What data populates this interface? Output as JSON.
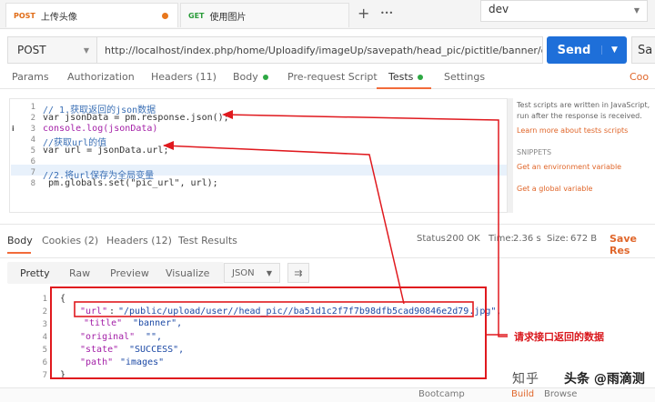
{
  "tabs": [
    {
      "method": "POST",
      "label": "上传头像"
    },
    {
      "method": "GET",
      "label": "使用图片"
    }
  ],
  "tab_add": "+",
  "tab_more": "•••",
  "environment": "dev",
  "request": {
    "method": "POST",
    "url": "http://localhost/index.php/home/Uploadify/imageUp/savepath/head_pic/pictitle/banner/dir/images",
    "send_label": "Send",
    "save_label": "Sa"
  },
  "request_tabs": [
    "Params",
    "Authorization",
    "Headers (11)",
    "Body",
    "Pre-request Script",
    "Tests",
    "Settings",
    "Coo"
  ],
  "editor_lines": [
    {
      "n": "1",
      "text": "// 1.获取返回的json数据"
    },
    {
      "n": "2",
      "text": "var jsonData = pm.response.json();"
    },
    {
      "n": "3",
      "text": "console.log(jsonData)",
      "info": "i"
    },
    {
      "n": "4",
      "text": "//获取url的值"
    },
    {
      "n": "5",
      "text": "var url = jsonData.url;"
    },
    {
      "n": "6",
      "text": ""
    },
    {
      "n": "7",
      "text": "//2.将url保存为全局变量"
    },
    {
      "n": "8",
      "text": " pm.globals.set(\"pic_url\", url);"
    }
  ],
  "side_panel": {
    "desc1": "Test scripts are written in JavaScript,",
    "desc2": "run after the response is received.",
    "learn": "Learn more about tests scripts",
    "snippets": "SNIPPETS",
    "snip1": "Get an environment variable",
    "snip2": "Get a global variable"
  },
  "response_tabs": [
    "Body",
    "Cookies (2)",
    "Headers (12)",
    "Test Results"
  ],
  "status": {
    "label": "Status:",
    "value": "200 OK",
    "time_label": "Time:",
    "time": "2.36 s",
    "size_label": "Size:",
    "size": "672 B"
  },
  "save_response": "Save Res",
  "view_tabs": [
    "Pretty",
    "Raw",
    "Preview",
    "Visualize"
  ],
  "format": "JSON",
  "response_lines": [
    {
      "n": "1",
      "text": "{"
    },
    {
      "n": "2",
      "key": "\"url\"",
      "val": "\"/public/upload/user//head_pic//ba51d1c2f7f7b98dfb5cad90846e2d79.jpg\","
    },
    {
      "n": "3",
      "key": "\"title\"",
      "val": "\"banner\","
    },
    {
      "n": "4",
      "key": "\"original\"",
      "val": "\"\","
    },
    {
      "n": "5",
      "key": "\"state\"",
      "val": "\"SUCCESS\","
    },
    {
      "n": "6",
      "key": "\"path\"",
      "val": "\"images\""
    },
    {
      "n": "7",
      "text": "}"
    }
  ],
  "annotation": "请求接口返回的数据",
  "watermark": {
    "a": "知乎",
    "b": "头条 @雨滴测试"
  },
  "footer": {
    "bootcamp": "Bootcamp",
    "build": "Build",
    "browse": "Browse"
  },
  "colors": {
    "accent": "#f26b3a",
    "send": "#1e6fd9",
    "annotation": "#d9171c"
  }
}
